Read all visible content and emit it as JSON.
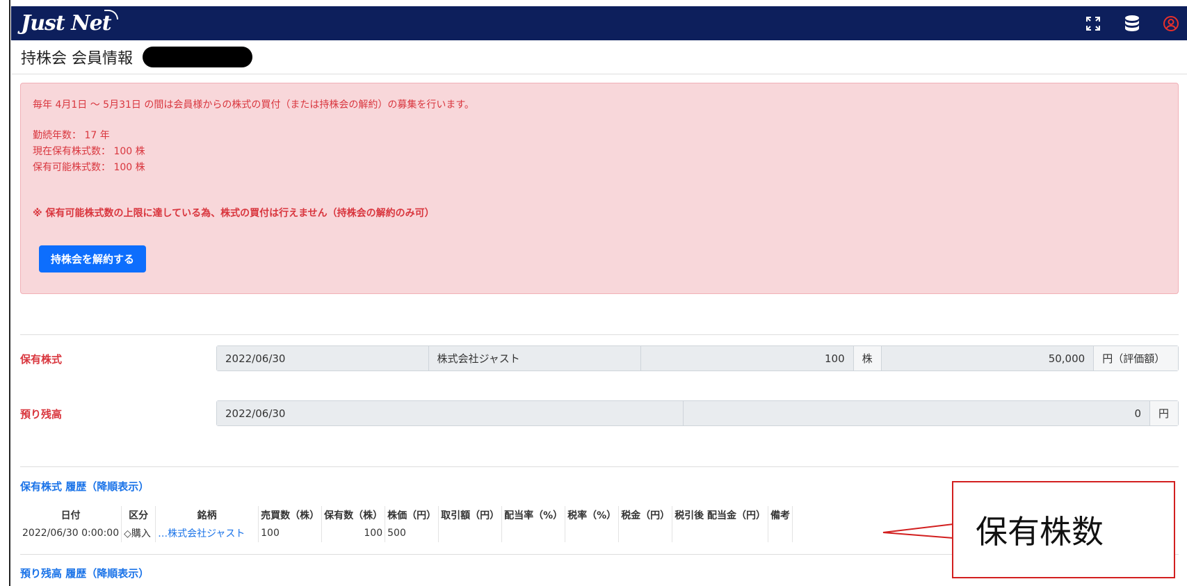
{
  "app": {
    "logo": "Just Net"
  },
  "header": {
    "icons": [
      "fullscreen-icon",
      "database-icon",
      "user-circle-icon"
    ]
  },
  "page": {
    "title": "持株会 会員情報"
  },
  "alert": {
    "period": "毎年 4月1日 ～ 5月31日 の間は会員様からの株式の買付（または持株会の解約）の募集を行います。",
    "years": "勤続年数： 17 年",
    "current_shares": "現在保有株式数： 100 株",
    "max_shares": "保有可能株式数： 100 株",
    "notice": "※ 保有可能株式数の上限に達している為、株式の買付は行えません（持株会の解約のみ可）",
    "button_label": "持株会を解約する"
  },
  "holdings": {
    "label": "保有株式",
    "date": "2022/06/30",
    "company": "株式会社ジャスト",
    "shares": "100",
    "shares_unit": "株",
    "value": "50,000",
    "value_unit": "円（評価額）"
  },
  "balance": {
    "label": "預り残高",
    "date": "2022/06/30",
    "amount": "0",
    "unit": "円"
  },
  "history": {
    "title": "保有株式 履歴（降順表示）",
    "headers": [
      "日付",
      "区分",
      "銘柄",
      "売買数（株）",
      "保有数（株）",
      "株価（円）",
      "取引額（円）",
      "配当率（%）",
      "税率（%）",
      "税金（円）",
      "税引後 配当金（円）",
      "備考"
    ],
    "rows": [
      {
        "date": "2022/06/30 0:00:00",
        "type": "◇購入",
        "name": "…株式会社ジャスト",
        "trade": "100",
        "held": "100",
        "price": "500",
        "amount": "",
        "div_rate": "",
        "tax_rate": "",
        "tax": "",
        "after_tax": "",
        "note": ""
      }
    ]
  },
  "balance_history": {
    "title": "預り残高 履歴（降順表示）"
  },
  "callout": {
    "text": "保有株数"
  },
  "colors": {
    "navbar": "#0d1f5c",
    "alert_bg": "#f8d7da",
    "alert_text": "#d9363e",
    "primary": "#0d6efd",
    "link": "#1a73e8",
    "callout": "#d21f1f"
  }
}
